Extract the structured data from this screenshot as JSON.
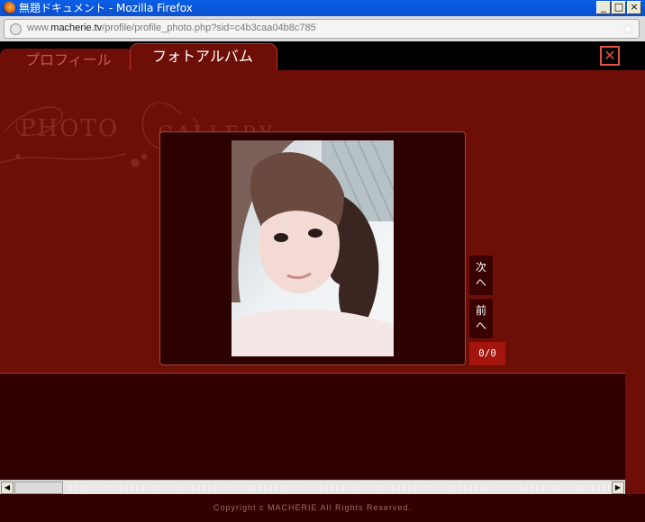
{
  "window": {
    "title": "無題ドキュメント - Mozilla Firefox",
    "buttons": [
      "_",
      "□",
      "×"
    ]
  },
  "address": {
    "url_prefix": "www.",
    "url_domain": "macherie.tv",
    "url_path": "/profile/profile_photo.php?sid=c4b3caa04b8c785"
  },
  "tabs": {
    "profile": "プロフィール",
    "photo_album": "フォトアルバム"
  },
  "close_label": "✕",
  "watermark": {
    "text1": "PHOTO",
    "text2": "GALLERY"
  },
  "navigation": {
    "next": "次\nへ",
    "prev": "前\nへ",
    "counter": "0/0"
  },
  "scrollbar": {
    "left_arrow": "◀",
    "right_arrow": "▶"
  },
  "footer": {
    "copyright": "Copyright c MACHERIE All Rights Reserved."
  },
  "colors": {
    "page_bg": "#6e0f07",
    "dark_panel": "#300000",
    "accent_red": "#a3150d"
  }
}
